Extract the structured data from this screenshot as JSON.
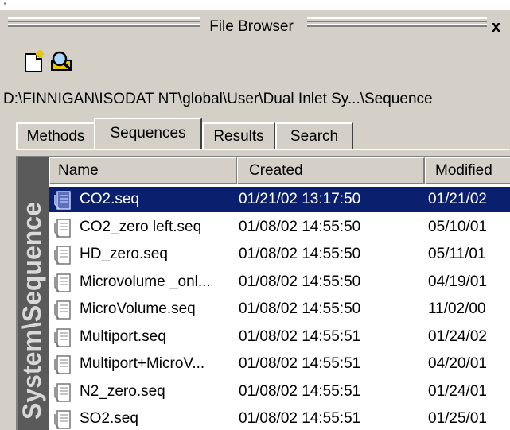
{
  "window": {
    "title": "File Browser",
    "close_glyph": "x"
  },
  "toolbar": {
    "buttons": [
      {
        "icon": "new-file-icon"
      },
      {
        "icon": "find-icon"
      }
    ]
  },
  "path": "D:\\FINNIGAN\\ISODAT NT\\global\\User\\Dual Inlet Sy...\\Sequence",
  "tabs": [
    {
      "label": "Methods",
      "active": false
    },
    {
      "label": "Sequences",
      "active": true
    },
    {
      "label": "Results",
      "active": false
    },
    {
      "label": "Search",
      "active": false
    }
  ],
  "sidebar_label": "System\\Sequence",
  "columns": {
    "name": "Name",
    "created": "Created",
    "modified": "Modified"
  },
  "files": [
    {
      "name": "CO2.seq",
      "created": "01/21/02 13:17:50",
      "modified": "01/21/02",
      "selected": true
    },
    {
      "name": "CO2_zero left.seq",
      "created": "01/08/02 14:55:50",
      "modified": "05/10/01",
      "selected": false
    },
    {
      "name": "HD_zero.seq",
      "created": "01/08/02 14:55:50",
      "modified": "05/11/01",
      "selected": false
    },
    {
      "name": "Microvolume _onl...",
      "created": "01/08/02 14:55:50",
      "modified": "04/19/01",
      "selected": false
    },
    {
      "name": "MicroVolume.seq",
      "created": "01/08/02 14:55:50",
      "modified": "11/02/00",
      "selected": false
    },
    {
      "name": "Multiport.seq",
      "created": "01/08/02 14:55:51",
      "modified": "01/24/02",
      "selected": false
    },
    {
      "name": "Multiport+MicroV...",
      "created": "01/08/02 14:55:51",
      "modified": "04/20/01",
      "selected": false
    },
    {
      "name": "N2_zero.seq",
      "created": "01/08/02 14:55:51",
      "modified": "01/24/01",
      "selected": false
    },
    {
      "name": "SO2.seq",
      "created": "01/08/02 14:55:51",
      "modified": "01/25/01",
      "selected": false
    }
  ],
  "colors": {
    "selection": "#0a1f6e",
    "chrome": "#d4d0c8",
    "sidebar": "#5a5a5a"
  }
}
